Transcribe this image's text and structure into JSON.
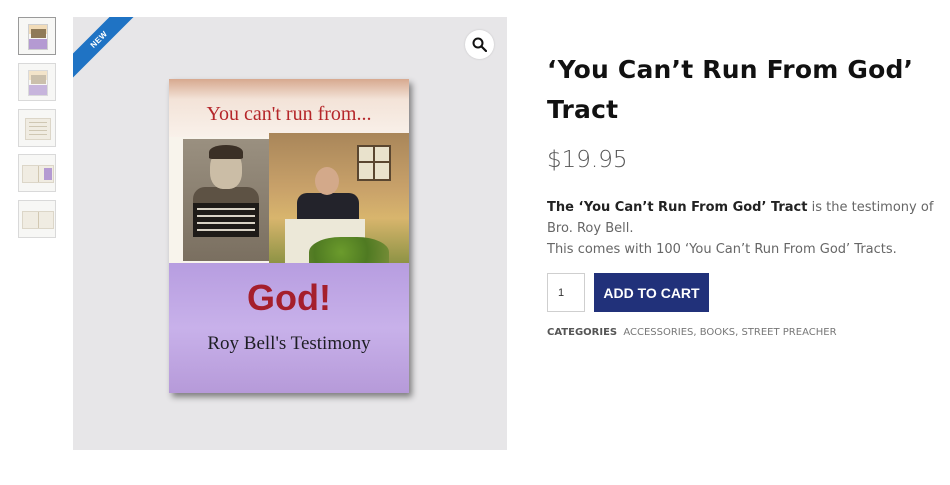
{
  "gallery": {
    "badge": "NEW",
    "zoom_icon": "magnifier-icon",
    "thumbnails": [
      "cover",
      "cover-alt",
      "page",
      "spread",
      "spread-alt"
    ],
    "cover": {
      "headline": "You can't run from...",
      "title": "God!",
      "subtitle": "Roy Bell's Testimony"
    }
  },
  "product": {
    "title": "‘You Can’t Run From God’ Tract",
    "price": "$19.95",
    "description": {
      "bold": "The ‘You Can’t Run From God’ Tract",
      "rest": " is the testimony of Bro. Roy Bell.",
      "line2": "This comes with 100 ‘You Can’t Run From God’ Tracts."
    },
    "quantity": "1",
    "add_to_cart": "ADD TO CART",
    "categories_label": "CATEGORIES",
    "categories": [
      "ACCESSORIES",
      "BOOKS",
      "STREET PREACHER"
    ]
  },
  "colors": {
    "button": "#21317a",
    "badge": "#1f73c4",
    "cover_purple": "#c8b1ea",
    "cover_red": "#a51f2c"
  }
}
